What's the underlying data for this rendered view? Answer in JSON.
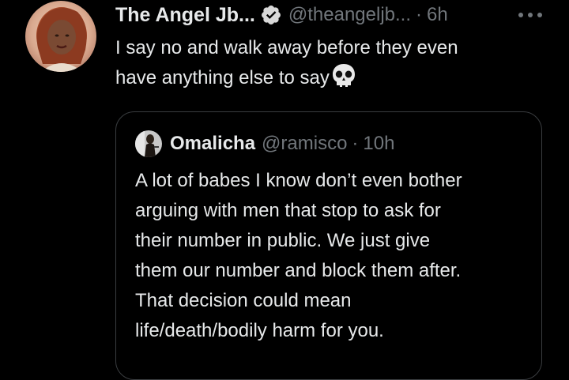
{
  "tweet": {
    "author": {
      "display_name": "The Angel Jb...",
      "handle": "@theangeljb...",
      "verified": true,
      "avatar_icon": "profile-photo"
    },
    "separator": "·",
    "time": "6h",
    "more_icon": "more-horizontal-icon",
    "text_lines": [
      "I say no and walk away before they even",
      "have anything else to say"
    ],
    "emoji": "skull-emoji"
  },
  "quote": {
    "author": {
      "display_name": "Omalicha",
      "handle": "@ramisco",
      "avatar_icon": "profile-photo"
    },
    "separator": "·",
    "time": "10h",
    "text_lines": [
      "A lot of babes I know don’t even bother",
      "arguing with men that stop to ask for",
      "their number in public. We just give",
      "them our number and block them after.",
      "That decision could mean",
      "life/death/bodily harm for you."
    ]
  },
  "colors": {
    "background": "#000000",
    "primary_text": "#e7e9ea",
    "secondary_text": "#71767b",
    "border": "#3a3d40",
    "verified_badge": "#d9d9d9"
  }
}
